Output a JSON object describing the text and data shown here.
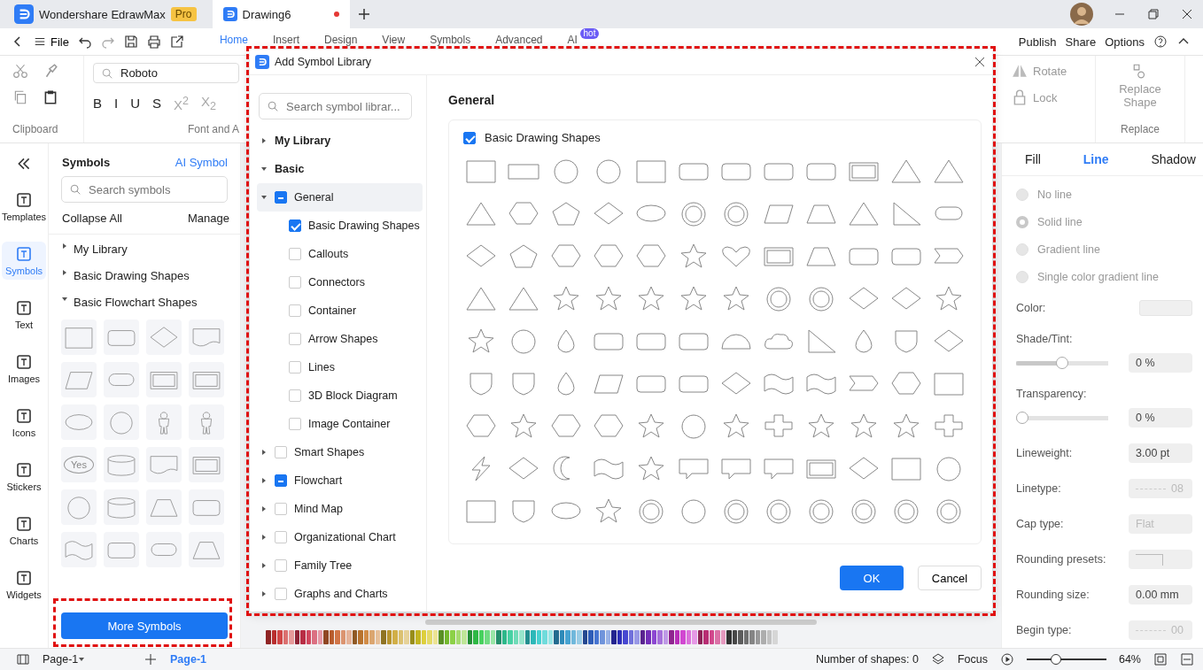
{
  "app": {
    "name": "Wondershare EdrawMax",
    "badge": "Pro"
  },
  "doc_tabs": [
    {
      "label": "Drawing6",
      "selected": true,
      "unsaved": true
    }
  ],
  "menu": {
    "file": "File",
    "tabs": [
      {
        "label": "Home",
        "selected": true
      },
      {
        "label": "Insert",
        "selected": false
      },
      {
        "label": "Design",
        "selected": false
      },
      {
        "label": "View",
        "selected": false
      },
      {
        "label": "Symbols",
        "selected": false
      },
      {
        "label": "Advanced",
        "selected": false
      },
      {
        "label": "AI",
        "selected": false,
        "badge": "hot"
      }
    ],
    "actions": [
      "Publish",
      "Share",
      "Options"
    ]
  },
  "ribbon": {
    "font": "Roboto",
    "format": [
      "B",
      "I",
      "U",
      "S",
      "X$^{2}$",
      "X$_{2}$"
    ],
    "groups": [
      "Clipboard",
      "Font and A"
    ],
    "rotate": "Rotate",
    "lock": "Lock",
    "replace_shape": "Replace Shape",
    "replace_group": "Replace"
  },
  "nav": [
    {
      "label": "Templates",
      "selected": false
    },
    {
      "label": "Symbols",
      "selected": true
    },
    {
      "label": "Text",
      "selected": false
    },
    {
      "label": "Images",
      "selected": false
    },
    {
      "label": "Icons",
      "selected": false
    },
    {
      "label": "Stickers",
      "selected": false
    },
    {
      "label": "Charts",
      "selected": false
    },
    {
      "label": "Widgets",
      "selected": false
    }
  ],
  "symbols_panel": {
    "title": "Symbols",
    "ai": "AI Symbol",
    "search_placeholder": "Search symbols",
    "collapse": "Collapse All",
    "manage": "Manage",
    "libraries": [
      {
        "name": "My Library",
        "expanded": false
      },
      {
        "name": "Basic Drawing Shapes",
        "expanded": false
      },
      {
        "name": "Basic Flowchart Shapes",
        "expanded": true
      }
    ],
    "shape_text": "Yes",
    "more": "More Symbols"
  },
  "dialog": {
    "title": "Add Symbol Library",
    "search_placeholder": "Search symbol librar...",
    "tree": [
      {
        "label": "My Library",
        "kind": "header",
        "expanded": false
      },
      {
        "label": "Basic",
        "kind": "header",
        "expanded": true,
        "children": [
          {
            "label": "General",
            "checked": false,
            "partial": true,
            "expanded": true,
            "selected": true,
            "children": [
              {
                "label": "Basic Drawing Shapes",
                "checked": true
              },
              {
                "label": "Callouts",
                "checked": false
              },
              {
                "label": "Connectors",
                "checked": false
              },
              {
                "label": "Container",
                "checked": false
              },
              {
                "label": "Arrow Shapes",
                "checked": false
              },
              {
                "label": "Lines",
                "checked": false
              },
              {
                "label": "3D Block Diagram",
                "checked": false
              },
              {
                "label": "Image Container",
                "checked": false
              }
            ]
          },
          {
            "label": "Smart Shapes",
            "checked": false,
            "partial": false,
            "expanded": false,
            "selected": false
          },
          {
            "label": "Flowchart",
            "checked": false,
            "partial": true,
            "expanded": false,
            "selected": false
          },
          {
            "label": "Mind Map",
            "checked": false,
            "partial": false,
            "expanded": false,
            "selected": false
          },
          {
            "label": "Organizational Chart",
            "checked": false,
            "partial": false,
            "expanded": false,
            "selected": false
          },
          {
            "label": "Family Tree",
            "checked": false,
            "partial": false,
            "expanded": false,
            "selected": false
          },
          {
            "label": "Graphs and Charts",
            "checked": false,
            "partial": false,
            "expanded": false,
            "selected": false
          }
        ]
      }
    ],
    "section": "General",
    "library": {
      "name": "Basic Drawing Shapes",
      "checked": true
    },
    "ok": "OK",
    "cancel": "Cancel"
  },
  "properties": {
    "tabs": [
      {
        "label": "Fill",
        "selected": false
      },
      {
        "label": "Line",
        "selected": true
      },
      {
        "label": "Shadow",
        "selected": false
      }
    ],
    "line_options": [
      {
        "label": "No line",
        "selected": false
      },
      {
        "label": "Solid line",
        "selected": true
      },
      {
        "label": "Gradient line",
        "selected": false
      },
      {
        "label": "Single color gradient line",
        "selected": false
      }
    ],
    "color_label": "Color:",
    "sliders": [
      {
        "label": "Shade/Tint:",
        "level": 0.5,
        "value": "0 %"
      },
      {
        "label": "Transparency:",
        "level": 0,
        "value": "0 %"
      }
    ],
    "fields": [
      {
        "label": "Lineweight:",
        "value": "3.00 pt",
        "kind": "spin",
        "disabled": false
      },
      {
        "label": "Linetype:",
        "value": "08",
        "kind": "linetype",
        "disabled": true
      },
      {
        "label": "Cap type:",
        "value": "Flat",
        "kind": "select",
        "disabled": true
      },
      {
        "label": "Rounding presets:",
        "kind": "corner",
        "disabled": true
      },
      {
        "label": "Rounding size:",
        "value": "0.00 mm",
        "kind": "spin",
        "disabled": false
      },
      {
        "label": "Begin type:",
        "value": "00",
        "kind": "linetype",
        "disabled": true
      }
    ]
  },
  "status": {
    "page_select": "Page-1",
    "page_tab": "Page-1",
    "shapes": "Number of shapes: 0",
    "focus": "Focus",
    "zoom": "64%",
    "zoom_slider": {
      "level": 0.35
    }
  }
}
